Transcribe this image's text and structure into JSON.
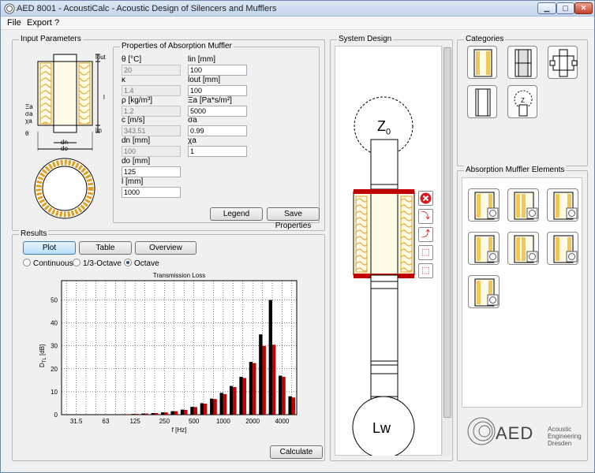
{
  "titlebar": {
    "title": "AED 8001 - AcoustiCalc - Acoustic Design of Silencers and Mufflers"
  },
  "menu": [
    "File",
    "Export",
    "?"
  ],
  "input": {
    "group_title": "Input Parameters",
    "props_title": "Properties of Absorption Muffler",
    "fig": {
      "lout": "lout",
      "l": "l",
      "lin": "lin",
      "xi": "Ξa",
      "sigma": "σa",
      "chi": "χa",
      "theta": "θ",
      "dn": "dn",
      "do": "do"
    },
    "left": [
      {
        "label": "θ [°C]",
        "value": "20",
        "ro": true
      },
      {
        "label": "κ",
        "value": "1.4",
        "ro": true
      },
      {
        "label": "ρ [kg/m³]",
        "value": "1.2",
        "ro": true
      },
      {
        "label": "c [m/s]",
        "value": "343.51",
        "ro": true
      },
      {
        "label": "dn [mm]",
        "value": "100",
        "ro": true
      },
      {
        "label": "do [mm]",
        "value": "125",
        "ro": false
      },
      {
        "label": "l [mm]",
        "value": "1000",
        "ro": false
      }
    ],
    "right": [
      {
        "label": "lin [mm]",
        "value": "100"
      },
      {
        "label": "lout [mm]",
        "value": "100"
      },
      {
        "label": "Ξa [Pa*s/m²]",
        "value": "5000"
      },
      {
        "label": "σa",
        "value": "0.99"
      },
      {
        "label": "χa",
        "value": "1"
      }
    ],
    "legend_btn": "Legend",
    "save_btn": "Save Properties"
  },
  "results": {
    "group_title": "Results",
    "tabs": [
      "Plot",
      "Table",
      "Overview"
    ],
    "radios": [
      "Continuous",
      "1/3-Octave",
      "Octave"
    ],
    "selected_radio": 2,
    "calc_btn": "Calculate"
  },
  "chart_data": {
    "type": "bar",
    "title": "Transmission Loss",
    "xlabel": "f [Hz]",
    "ylabel": "D",
    "ylabel_sub": "TL",
    "ylabel_unit": " [dB]",
    "ylim": [
      0,
      55
    ],
    "yticks": [
      0,
      10,
      20,
      30,
      40,
      50
    ],
    "xtick_labels": [
      "31.5",
      "63",
      "125",
      "250",
      "500",
      "1000",
      "2000",
      "4000"
    ],
    "categories": [
      "25",
      "31.5",
      "40",
      "50",
      "63",
      "80",
      "100",
      "125",
      "160",
      "200",
      "250",
      "315",
      "400",
      "500",
      "630",
      "800",
      "1000",
      "1250",
      "1600",
      "2000",
      "2500",
      "3150",
      "4000",
      "5000"
    ],
    "series": [
      {
        "color": "#000000",
        "values": [
          0,
          0,
          0,
          0,
          0,
          0,
          0.2,
          0.3,
          0.5,
          0.7,
          1.0,
          1.5,
          2.2,
          3.4,
          5.0,
          7.0,
          9.5,
          12.5,
          16.5,
          23.0,
          35.0,
          50.0,
          17.0,
          8.0
        ]
      },
      {
        "color": "#c00000",
        "values": [
          0,
          0,
          0,
          0,
          0,
          0,
          0.2,
          0.3,
          0.5,
          0.7,
          1.0,
          1.5,
          2.1,
          3.3,
          4.8,
          6.8,
          9.0,
          12.0,
          16.0,
          22.5,
          30.0,
          30.5,
          16.5,
          7.5
        ]
      }
    ],
    "grid": true
  },
  "system": {
    "group_title": "System Design",
    "z0": "Z",
    "z0_sub": "0",
    "lw": "Lw"
  },
  "categories": {
    "group_title": "Categories"
  },
  "elements": {
    "group_title": "Absorption Muffler Elements"
  },
  "logo": {
    "mark": "AED",
    "l1": "Acoustic",
    "l2": "Engineering",
    "l3": "Dresden"
  }
}
